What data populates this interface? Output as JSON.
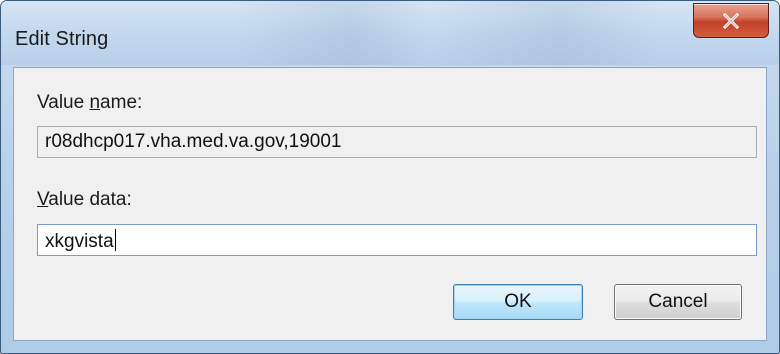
{
  "window": {
    "title": "Edit String",
    "close_icon": "close-icon"
  },
  "form": {
    "value_name_label_prefix": "Value ",
    "value_name_label_mnemonic": "n",
    "value_name_label_suffix": "ame:",
    "value_name": "r08dhcp017.vha.med.va.gov,19001",
    "value_data_label_mnemonic": "V",
    "value_data_label_suffix": "alue data:",
    "value_data": "xkgvista"
  },
  "buttons": {
    "ok_label": "OK",
    "cancel_label": "Cancel"
  },
  "colors": {
    "close_button": "#c2412a",
    "ok_border": "#3c7fb1",
    "client_bg": "#f0f0f0"
  }
}
